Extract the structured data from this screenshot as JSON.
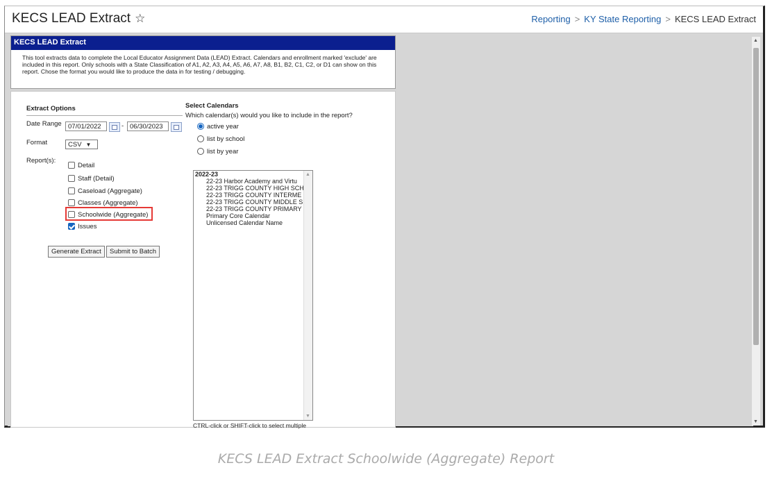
{
  "header": {
    "title": "KECS LEAD Extract",
    "breadcrumb": [
      "Reporting",
      "KY State Reporting",
      "KECS LEAD Extract"
    ]
  },
  "tool": {
    "heading": "KECS LEAD Extract",
    "description": "This tool extracts data to complete the Local Educator Assignment Data (LEAD) Extract. Calendars and enrollment marked 'exclude' are included in this report. Only schools with a State Classification of A1, A2, A3, A4, A5, A6, A7, A8, B1, B2, C1, C2, or D1 can show on this report. Chose the format you would like to produce the data in for testing / debugging."
  },
  "extract_options": {
    "title": "Extract Options",
    "date_range_label": "Date Range",
    "start_date": "07/01/2022",
    "date_sep": "-",
    "end_date": "06/30/2023",
    "format_label": "Format",
    "format_value": "CSV",
    "reports_label": "Report(s):",
    "reports": [
      {
        "label": "Detail",
        "checked": false
      },
      {
        "label": "Staff (Detail)",
        "checked": false
      },
      {
        "label": "Caseload (Aggregate)",
        "checked": false
      },
      {
        "label": "Classes (Aggregate)",
        "checked": false
      },
      {
        "label": "Schoolwide (Aggregate)",
        "checked": false
      },
      {
        "label": "Issues",
        "checked": true
      }
    ],
    "generate_button": "Generate Extract",
    "batch_button": "Submit to Batch"
  },
  "calendars": {
    "title": "Select Calendars",
    "question": "Which calendar(s) would you like to include in the report?",
    "options": [
      {
        "label": "active year",
        "selected": true
      },
      {
        "label": "list by school",
        "selected": false
      },
      {
        "label": "list by year",
        "selected": false
      }
    ],
    "group": "2022-23",
    "items": [
      "22-23 Harbor Academy and Virtu",
      "22-23 TRIGG COUNTY HIGH SCH",
      "22-23 TRIGG COUNTY INTERME",
      "22-23 TRIGG COUNTY MIDDLE S",
      "22-23 TRIGG COUNTY PRIMARY",
      "Primary Core Calendar",
      "Unlicensed Calendar Name"
    ],
    "hint": "CTRL-click or SHIFT-click to select multiple"
  },
  "caption": "KECS LEAD Extract Schoolwide (Aggregate) Report",
  "colors": {
    "header_bar": "#0b1f8f",
    "link": "#1e5fa8",
    "highlight": "#e53935",
    "check": "#1565c0"
  }
}
